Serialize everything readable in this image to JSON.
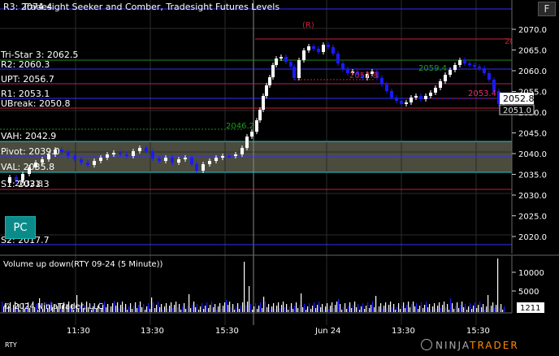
{
  "header": {
    "top_level_label": "R3: 2074.4",
    "title": "Tradesight Seeker and Comber, Tradesight Futures Levels"
  },
  "buttons": {
    "f_label": "F",
    "pc_label": "PC"
  },
  "price_axis": {
    "ticks": [
      "2070.0",
      "2065.0",
      "2060.0",
      "2055.0",
      "2050.0",
      "2045.0",
      "2040.0",
      "2035.0",
      "2030.0",
      "2025.0",
      "2020.0"
    ]
  },
  "level_labels": {
    "tristar": "Tri-Star 3: 2062.5",
    "r2": "R2: 2060.3",
    "upt": "UPT: 2056.7",
    "r1": "R1: 2053.1",
    "ubreak": "UBreak: 2050.8",
    "vah": "VAH: 2042.9",
    "pivot": "Pivot: 2039.0",
    "val": "VAL: 2035.8",
    "s1": "S1: 2031.3",
    "s2": "S2: 2017.7"
  },
  "markers": {
    "r_marker": "(R)",
    "right_r": "2(",
    "price_2053": "2053.4",
    "price_2059": "2059.4",
    "price_2057": "2057.8",
    "price_2046": "2046.2",
    "price_2032": "2032.8"
  },
  "price_badges": {
    "last": "2052.8",
    "second": "2051.0"
  },
  "volume": {
    "title": "Volume up down(RTY 09-24 (5 Minute))",
    "ticks": [
      "10000",
      "5000"
    ],
    "last": "1211"
  },
  "time_axis": {
    "labels": [
      "11:30",
      "13:30",
      "15:30",
      "Jun 24",
      "13:30",
      "15:30"
    ]
  },
  "footer": {
    "copyright": "© 2024 NinjaTrader, LLC",
    "symbol": "RTY",
    "brand_left": "NINJA",
    "brand_right": "TRADER"
  },
  "colors": {
    "up": "#ffffff",
    "down": "#1a1aff",
    "level_blue": "#2a2aff",
    "level_red": "#c81e3c",
    "level_green": "#1f8a1f",
    "level_cyan": "#23c8c8",
    "value_band": "#4a4a3a"
  }
}
